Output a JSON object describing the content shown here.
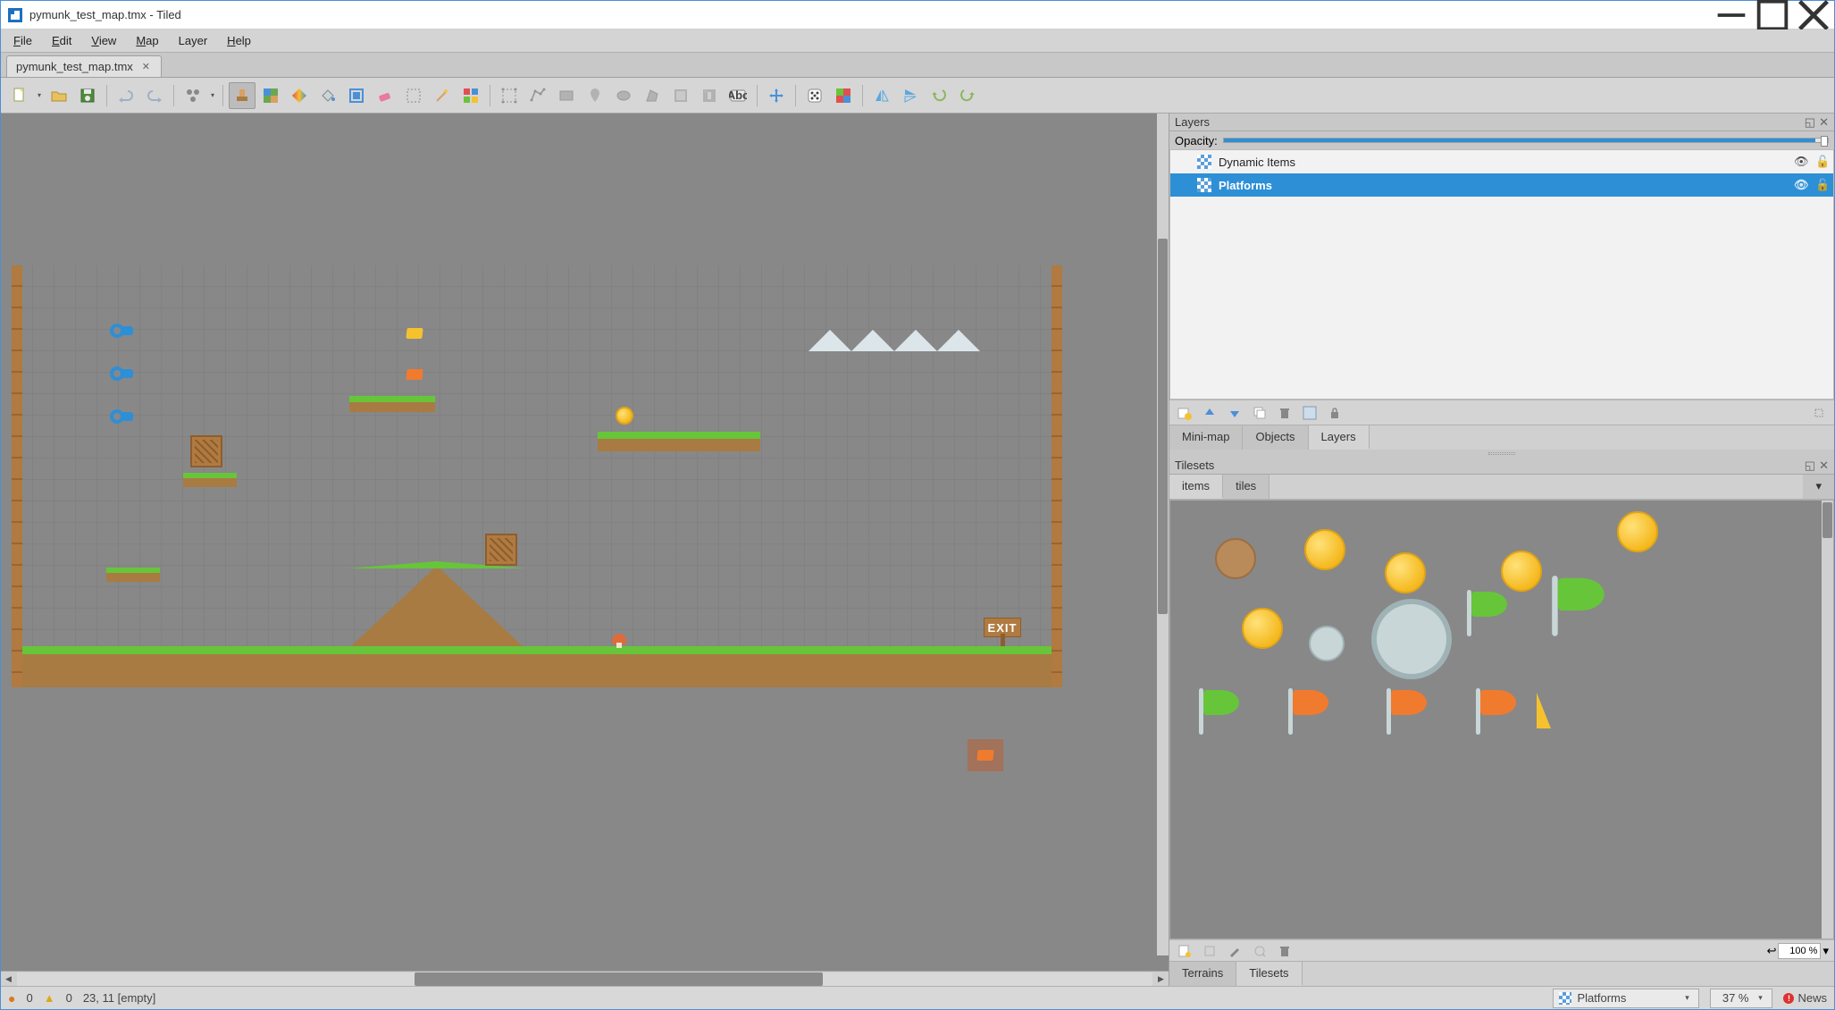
{
  "window": {
    "title": "pymunk_test_map.tmx - Tiled"
  },
  "menu": {
    "file": "File",
    "edit": "Edit",
    "view": "View",
    "map": "Map",
    "layer": "Layer",
    "help": "Help"
  },
  "tabs": {
    "current": "pymunk_test_map.tmx"
  },
  "panels": {
    "layers": {
      "title": "Layers",
      "opacity_label": "Opacity:",
      "items": [
        {
          "name": "Dynamic Items",
          "selected": false
        },
        {
          "name": "Platforms",
          "selected": true
        }
      ],
      "tabs": {
        "minimap": "Mini-map",
        "objects": "Objects",
        "layers": "Layers"
      }
    },
    "tilesets": {
      "title": "Tilesets",
      "tabs": {
        "items": "items",
        "tiles": "tiles"
      },
      "zoom": "100 %",
      "bottom_tabs": {
        "terrains": "Terrains",
        "tilesets": "Tilesets"
      }
    }
  },
  "status": {
    "err_count": "0",
    "warn_count": "0",
    "cursor": "23, 11 [empty]",
    "layer_selector": "Platforms",
    "zoom": "37 %",
    "news": "News"
  },
  "map_sprites": {
    "exit_text": "EXIT"
  }
}
